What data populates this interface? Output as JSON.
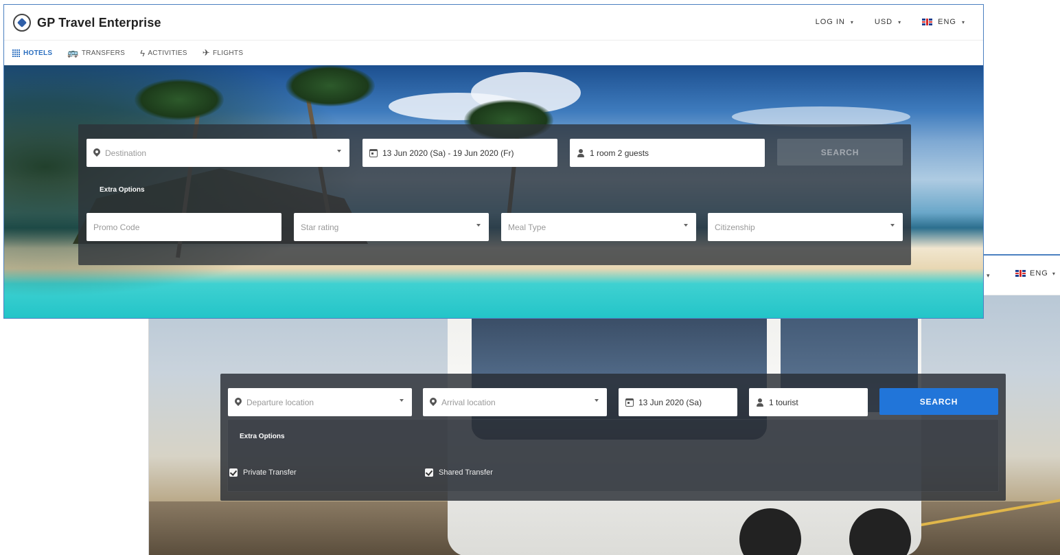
{
  "hotels_window": {
    "app_title": "GP Travel Enterprise",
    "header": {
      "login_label": "LOG IN",
      "currency_label": "USD",
      "language_label": "ENG"
    },
    "tabs": [
      {
        "label": "HOTELS",
        "icon": "hotel-icon",
        "active": true
      },
      {
        "label": "TRANSFERS",
        "icon": "bus-icon",
        "active": false
      },
      {
        "label": "ACTIVITIES",
        "icon": "bolt-icon",
        "active": false
      },
      {
        "label": "FLIGHTS",
        "icon": "plane-icon",
        "active": false
      }
    ],
    "search": {
      "destination_placeholder": "Destination",
      "dates_value": "13 Jun 2020 (Sa) -  19 Jun 2020 (Fr)",
      "guests_value": "1 room 2 guests",
      "search_label": "SEARCH",
      "extra_options_label": "Extra Options",
      "promo_placeholder": "Promo Code",
      "star_placeholder": "Star rating",
      "meal_placeholder": "Meal Type",
      "citizenship_placeholder": "Citizenship"
    }
  },
  "transfers_window": {
    "header": {
      "language_label": "ENG"
    },
    "search": {
      "departure_placeholder": "Departure location",
      "arrival_placeholder": "Arrival location",
      "date_value": "13 Jun 2020 (Sa)",
      "tourists_value": "1 tourist",
      "search_label": "SEARCH",
      "extra_options_label": "Extra Options",
      "private_transfer_label": "Private Transfer",
      "private_transfer_checked": true,
      "shared_transfer_label": "Shared Transfer",
      "shared_transfer_checked": true
    }
  },
  "colors": {
    "accent": "#2a6ebf",
    "search_button": "#2175d9",
    "panel": "#2d3239"
  }
}
